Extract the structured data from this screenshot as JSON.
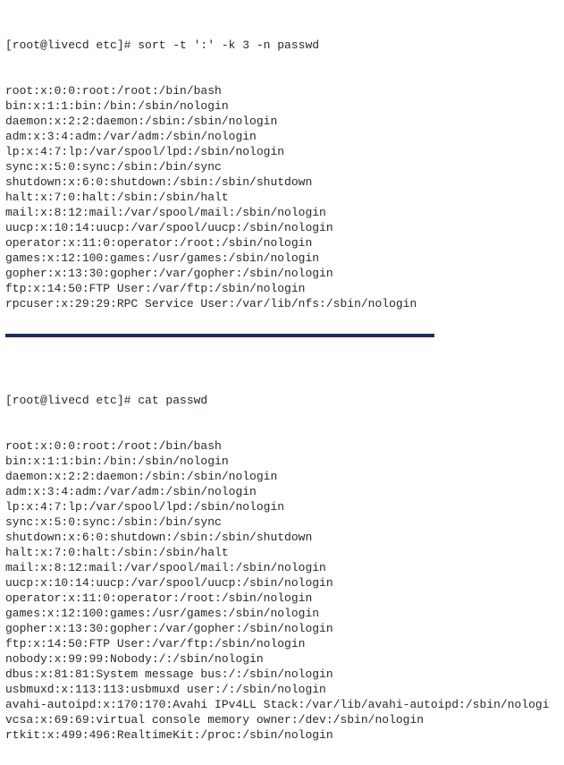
{
  "top": {
    "prompt": "[root@livecd etc]# sort -t ':' -k 3 -n passwd",
    "lines": [
      "root:x:0:0:root:/root:/bin/bash",
      "bin:x:1:1:bin:/bin:/sbin/nologin",
      "daemon:x:2:2:daemon:/sbin:/sbin/nologin",
      "adm:x:3:4:adm:/var/adm:/sbin/nologin",
      "lp:x:4:7:lp:/var/spool/lpd:/sbin/nologin",
      "sync:x:5:0:sync:/sbin:/bin/sync",
      "shutdown:x:6:0:shutdown:/sbin:/sbin/shutdown",
      "halt:x:7:0:halt:/sbin:/sbin/halt",
      "mail:x:8:12:mail:/var/spool/mail:/sbin/nologin",
      "uucp:x:10:14:uucp:/var/spool/uucp:/sbin/nologin",
      "operator:x:11:0:operator:/root:/sbin/nologin",
      "games:x:12:100:games:/usr/games:/sbin/nologin",
      "gopher:x:13:30:gopher:/var/gopher:/sbin/nologin",
      "ftp:x:14:50:FTP User:/var/ftp:/sbin/nologin",
      "rpcuser:x:29:29:RPC Service User:/var/lib/nfs:/sbin/nologin"
    ]
  },
  "bottom": {
    "prompt": "[root@livecd etc]# cat passwd",
    "lines": [
      "root:x:0:0:root:/root:/bin/bash",
      "bin:x:1:1:bin:/bin:/sbin/nologin",
      "daemon:x:2:2:daemon:/sbin:/sbin/nologin",
      "adm:x:3:4:adm:/var/adm:/sbin/nologin",
      "lp:x:4:7:lp:/var/spool/lpd:/sbin/nologin",
      "sync:x:5:0:sync:/sbin:/bin/sync",
      "shutdown:x:6:0:shutdown:/sbin:/sbin/shutdown",
      "halt:x:7:0:halt:/sbin:/sbin/halt",
      "mail:x:8:12:mail:/var/spool/mail:/sbin/nologin",
      "uucp:x:10:14:uucp:/var/spool/uucp:/sbin/nologin",
      "operator:x:11:0:operator:/root:/sbin/nologin",
      "games:x:12:100:games:/usr/games:/sbin/nologin",
      "gopher:x:13:30:gopher:/var/gopher:/sbin/nologin",
      "ftp:x:14:50:FTP User:/var/ftp:/sbin/nologin",
      "nobody:x:99:99:Nobody:/:/sbin/nologin",
      "dbus:x:81:81:System message bus:/:/sbin/nologin",
      "usbmuxd:x:113:113:usbmuxd user:/:/sbin/nologin",
      "avahi-autoipd:x:170:170:Avahi IPv4LL Stack:/var/lib/avahi-autoipd:/sbin/nologi",
      "vcsa:x:69:69:virtual console memory owner:/dev:/sbin/nologin",
      "rtkit:x:499:496:RealtimeKit:/proc:/sbin/nologin"
    ]
  }
}
